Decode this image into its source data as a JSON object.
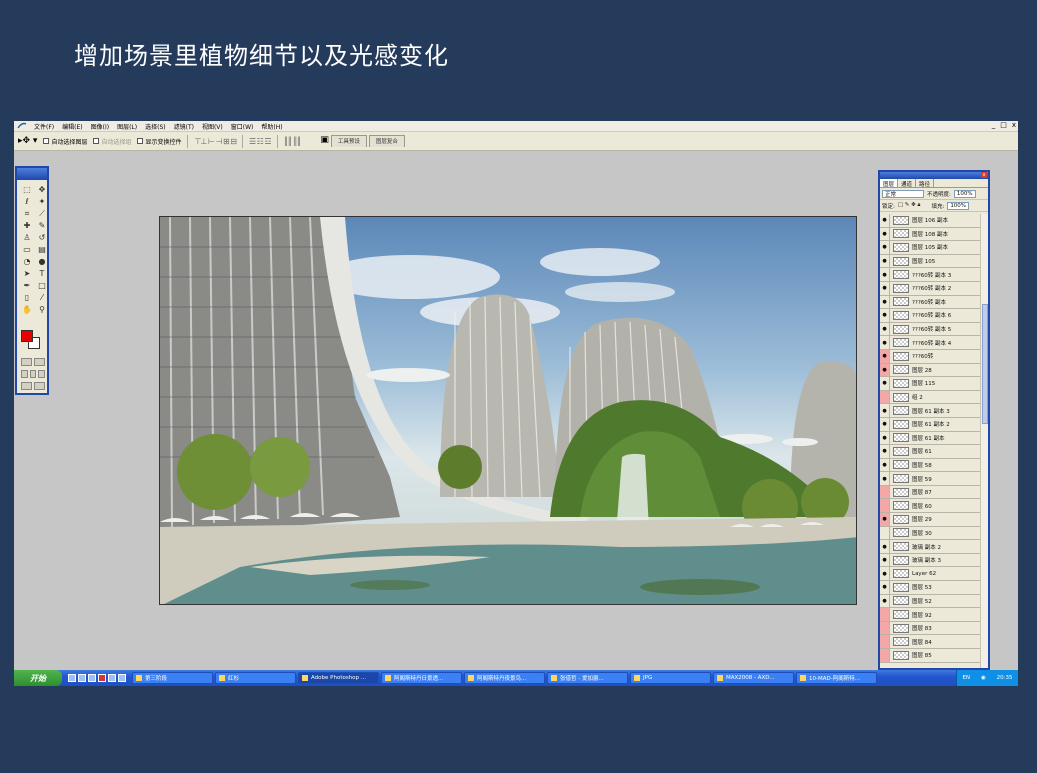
{
  "slide_title": "增加场景里植物细节以及光感变化",
  "menu": [
    "文件(F)",
    "编辑(E)",
    "图像(I)",
    "图层(L)",
    "选择(S)",
    "滤镜(T)",
    "视图(V)",
    "窗口(W)",
    "帮助(H)"
  ],
  "window_controls": [
    "_",
    "□",
    "x"
  ],
  "options": {
    "auto_select_layer": "自动选择图层",
    "auto_select_group": "自动选择组",
    "show_transform": "显示变换控件"
  },
  "palette_well": [
    "工具预设",
    "图层复合"
  ],
  "layers_panel": {
    "tabs": [
      "图层",
      "通道",
      "路径"
    ],
    "blend_mode": "正常",
    "opacity_label": "不透明度:",
    "opacity": "100%",
    "lock_label": "锁定:",
    "fill_label": "填充:",
    "fill": "100%",
    "layers": [
      {
        "name": "图层 106 副本",
        "eye": "●",
        "pink": false
      },
      {
        "name": "图层 108 副本",
        "eye": "●",
        "pink": false
      },
      {
        "name": "图层 105 副本",
        "eye": "●",
        "pink": false
      },
      {
        "name": "图层 105",
        "eye": "●",
        "pink": false
      },
      {
        "name": "???60转 副本 3",
        "eye": "●",
        "pink": false
      },
      {
        "name": "???60转 副本 2",
        "eye": "●",
        "pink": false
      },
      {
        "name": "???60转 副本",
        "eye": "●",
        "pink": false
      },
      {
        "name": "???60转 副本 6",
        "eye": "●",
        "pink": false
      },
      {
        "name": "???60转 副本 5",
        "eye": "●",
        "pink": false
      },
      {
        "name": "???60转 副本 4",
        "eye": "●",
        "pink": false
      },
      {
        "name": "???60转",
        "eye": "●",
        "pink": true
      },
      {
        "name": "图层 28",
        "eye": "●",
        "pink": true
      },
      {
        "name": "图层 115",
        "eye": "●",
        "pink": false
      },
      {
        "name": "组 2",
        "eye": "",
        "pink": true
      },
      {
        "name": "图层 61 副本 3",
        "eye": "●",
        "pink": false
      },
      {
        "name": "图层 61 副本 2",
        "eye": "●",
        "pink": false
      },
      {
        "name": "图层 61 副本",
        "eye": "●",
        "pink": false
      },
      {
        "name": "图层 61",
        "eye": "●",
        "pink": false
      },
      {
        "name": "图层 58",
        "eye": "●",
        "pink": false
      },
      {
        "name": "图层 59",
        "eye": "●",
        "pink": false
      },
      {
        "name": "图层 87",
        "eye": "",
        "pink": true
      },
      {
        "name": "图层 60",
        "eye": "",
        "pink": true
      },
      {
        "name": "图层 29",
        "eye": "●",
        "pink": true
      },
      {
        "name": "图层 30",
        "eye": "",
        "pink": false
      },
      {
        "name": "玻璃 副本 2",
        "eye": "●",
        "pink": false
      },
      {
        "name": "玻璃 副本 3",
        "eye": "●",
        "pink": false
      },
      {
        "name": "Layer 62",
        "eye": "●",
        "pink": false
      },
      {
        "name": "图层 53",
        "eye": "●",
        "pink": false
      },
      {
        "name": "图层 52",
        "eye": "●",
        "pink": false
      },
      {
        "name": "图层 92",
        "eye": "",
        "pink": true
      },
      {
        "name": "图层 83",
        "eye": "",
        "pink": true
      },
      {
        "name": "图层 84",
        "eye": "",
        "pink": true
      },
      {
        "name": "图层 85",
        "eye": "",
        "pink": true
      }
    ]
  },
  "taskbar": {
    "start": "开始",
    "tasks": [
      "第三阶段",
      "红杉",
      "Adobe Photoshop ...",
      "阿阁斯特丹日景透...",
      "阿阁斯特丹夜景鸟...",
      "张借哲 - 爱加爵...",
      "JPG",
      "MAX2008 - AXD...",
      "10-MAD-阿阁斯特..."
    ],
    "tray_lang": "EN",
    "clock": "20:35"
  },
  "colors": {
    "slide_bg": "#243b5c",
    "foreground_swatch": "#e60000",
    "xp_blue": "#2457cf"
  }
}
